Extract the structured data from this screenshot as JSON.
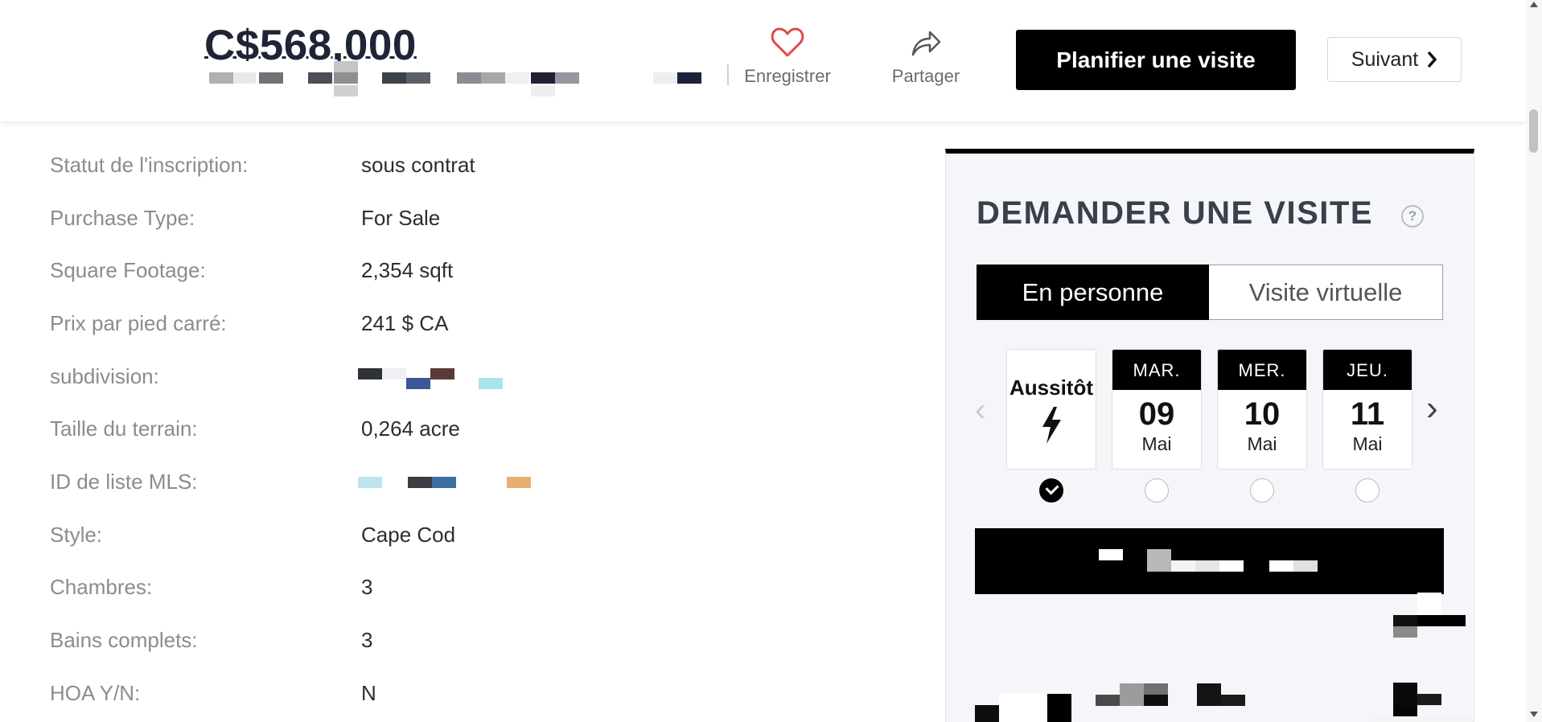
{
  "header": {
    "price": "C$568,000",
    "save_label": "Enregistrer",
    "share_label": "Partager",
    "schedule_button": "Planifier une visite",
    "next_button": "Suivant"
  },
  "details": [
    {
      "label": "Statut de l'inscription:",
      "value": "sous contrat"
    },
    {
      "label": "Purchase Type:",
      "value": "For Sale"
    },
    {
      "label": "Square Footage:",
      "value": "2,354 sqft"
    },
    {
      "label": "Prix par pied carré:",
      "value": "241 $ CA"
    },
    {
      "label": "subdivision:",
      "value": null
    },
    {
      "label": "Taille du terrain:",
      "value": "0,264 acre"
    },
    {
      "label": "ID de liste MLS:",
      "value": null
    },
    {
      "label": "Style:",
      "value": "Cape Cod"
    },
    {
      "label": "Chambres:",
      "value": "3"
    },
    {
      "label": "Bains complets:",
      "value": "3"
    },
    {
      "label": "HOA Y/N:",
      "value": "N"
    }
  ],
  "tour_panel": {
    "title": "DEMANDER UNE VISITE",
    "help_icon": "?",
    "modes": [
      "En personne",
      "Visite virtuelle"
    ],
    "active_mode": "En personne",
    "dates": [
      {
        "type": "asap",
        "label": "Aussitôt",
        "selected": true
      },
      {
        "dow": "MAR.",
        "day": "09",
        "month": "Mai",
        "selected": false
      },
      {
        "dow": "MER.",
        "day": "10",
        "month": "Mai",
        "selected": false
      },
      {
        "dow": "JEU.",
        "day": "11",
        "month": "Mai",
        "selected": false
      }
    ]
  },
  "colors": {
    "price": "#1f2436",
    "primary_button": "#000000",
    "label_gray": "#8c8c8c",
    "heart_red": "#e04a4a",
    "panel_bg": "#f4f6fa"
  },
  "icons": {
    "save": "heart-icon",
    "share": "share-arrow-icon",
    "next": "chevron-right-icon",
    "asap": "lightning-bolt-icon"
  }
}
